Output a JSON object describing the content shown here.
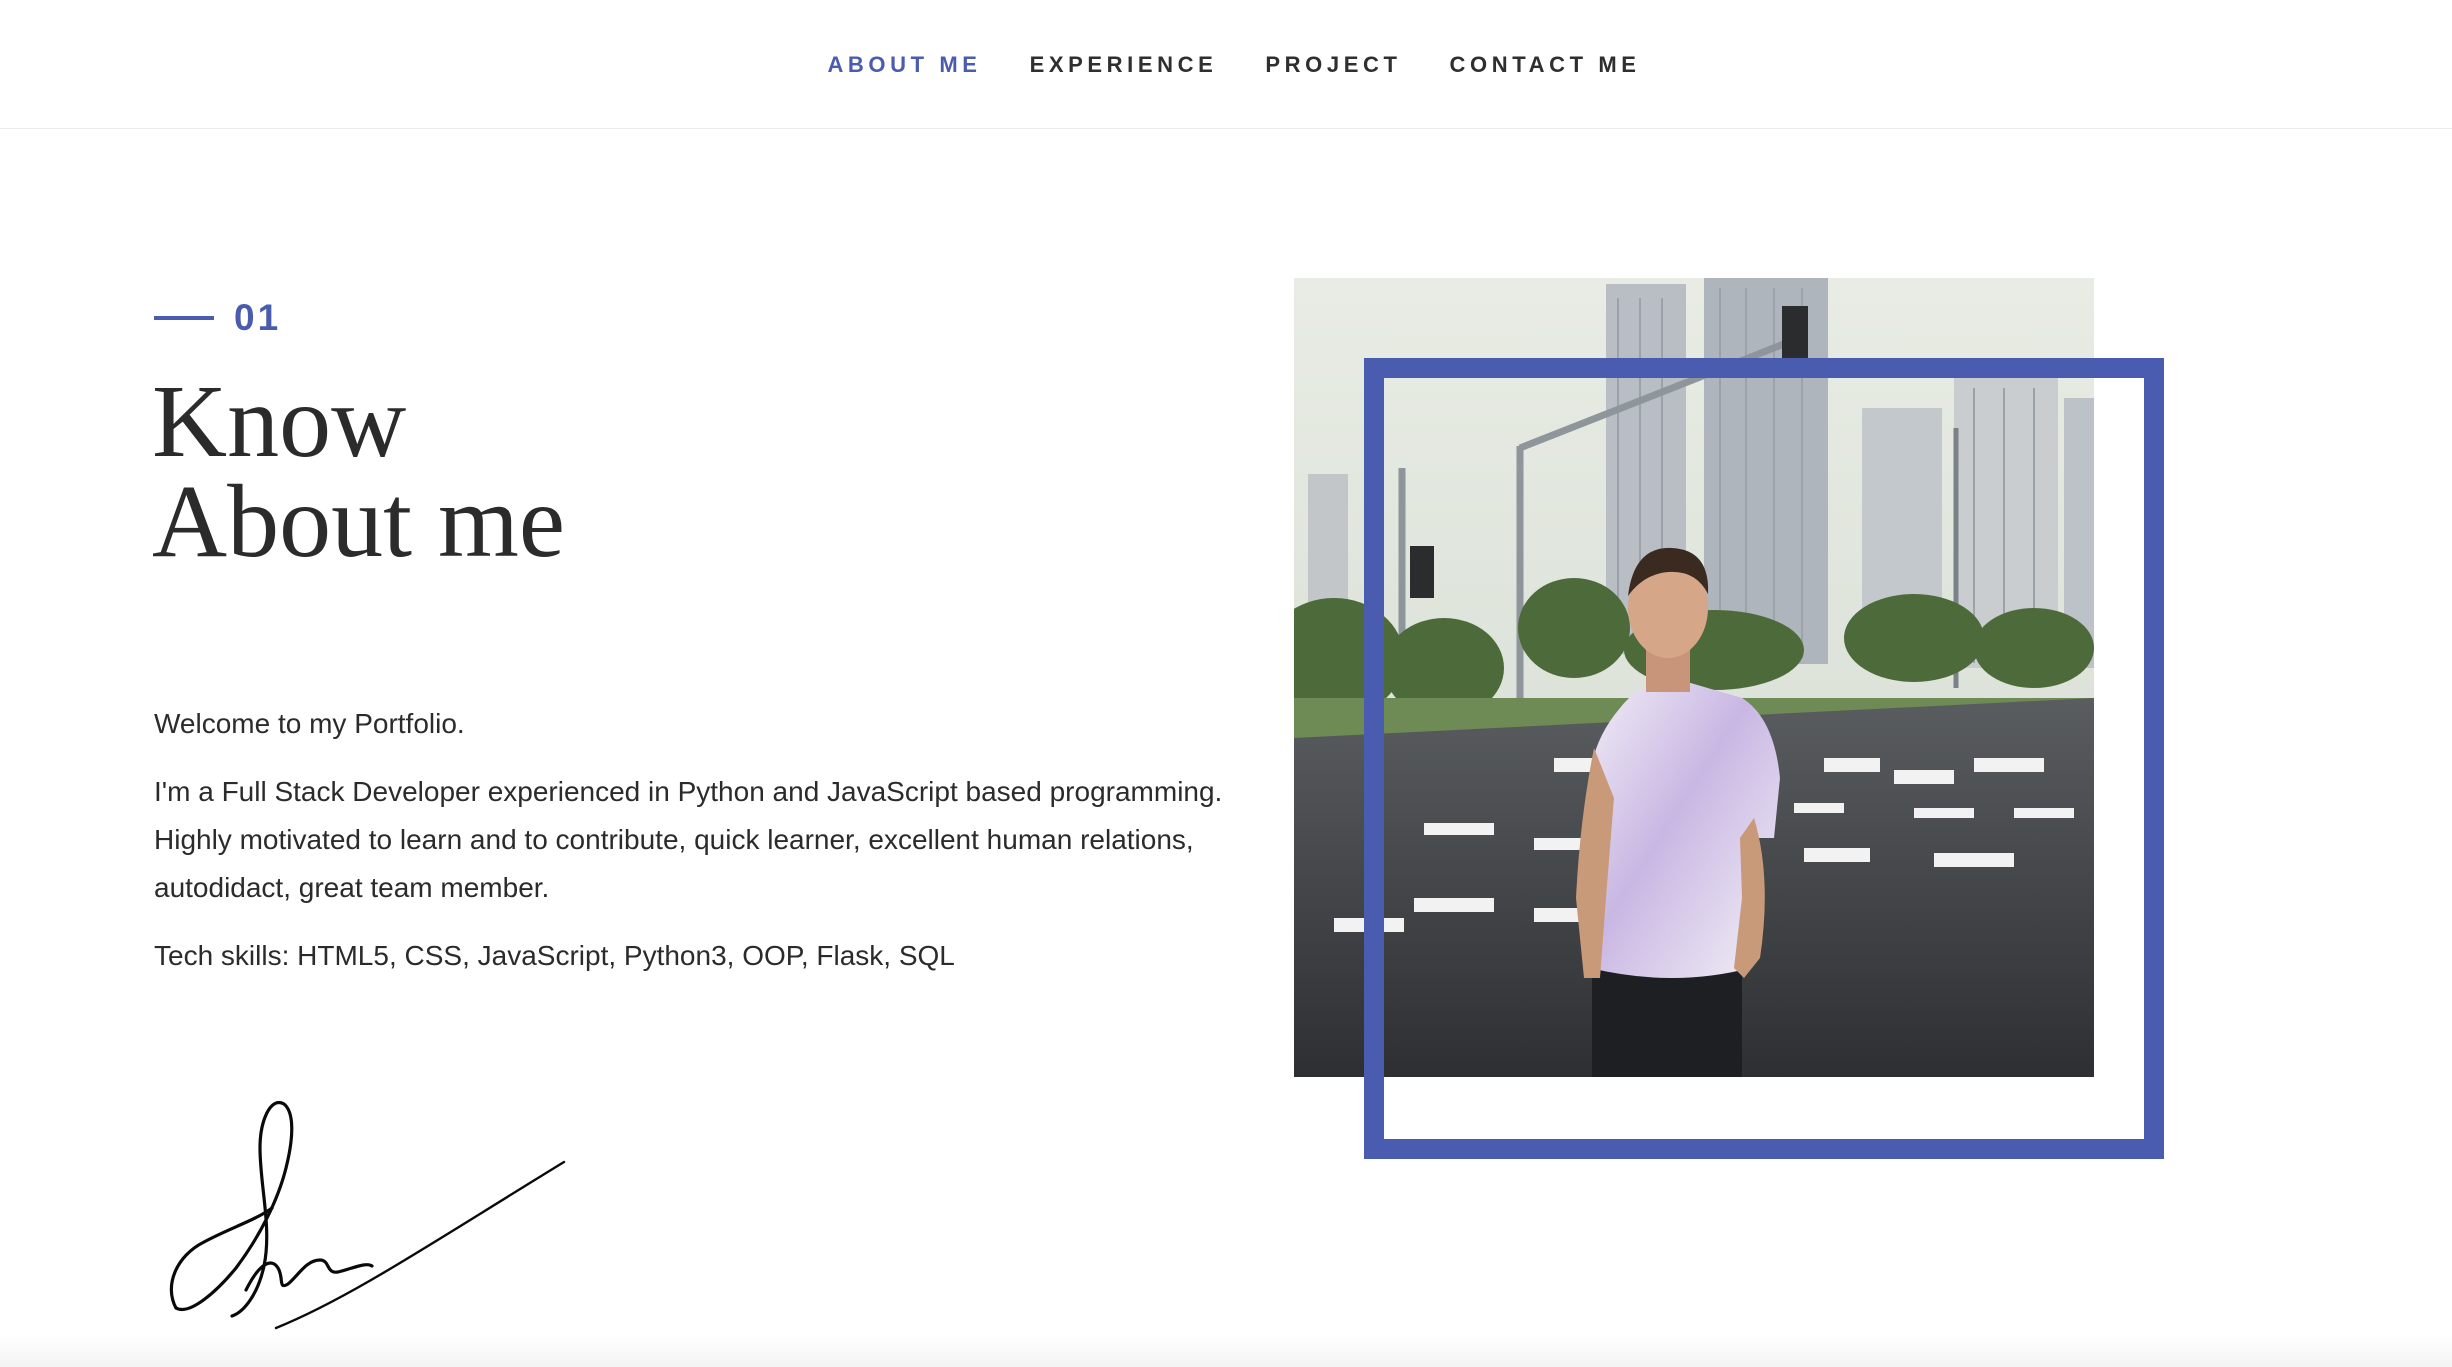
{
  "nav": {
    "items": [
      {
        "label": "ABOUT ME",
        "active": true
      },
      {
        "label": "EXPERIENCE",
        "active": false
      },
      {
        "label": "PROJECT",
        "active": false
      },
      {
        "label": "CONTACT ME",
        "active": false
      }
    ]
  },
  "about": {
    "section_number": "01",
    "heading_line1": "Know",
    "heading_line2": "About me",
    "paragraphs": [
      "Welcome to my Portfolio.",
      "I'm a Full Stack Developer experienced in Python and JavaScript based programming. Highly motivated to learn and to contribute, quick learner, excellent human relations, autodidact, great team member.",
      "Tech skills: HTML5, CSS, JavaScript, Python3, OOP, Flask, SQL"
    ]
  },
  "colors": {
    "accent": "#4a5cb0",
    "text": "#2b2b2b"
  }
}
